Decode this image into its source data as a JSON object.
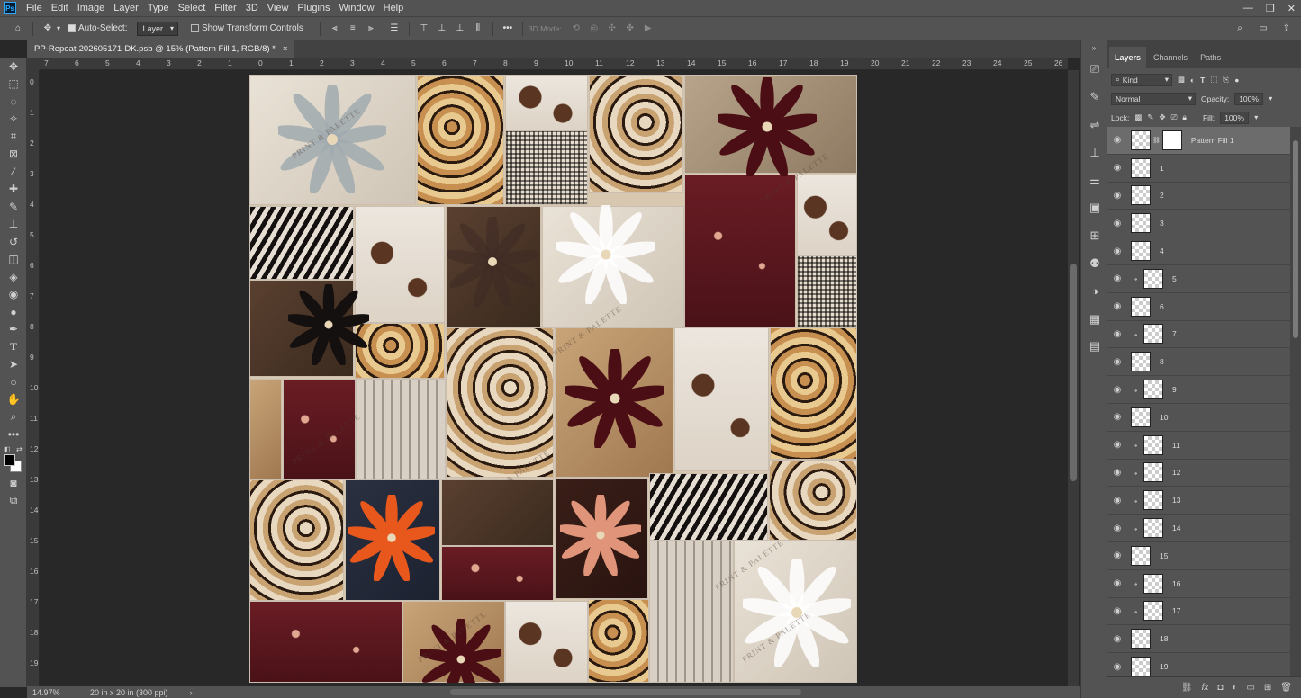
{
  "menubar": {
    "logo": "Ps",
    "items": [
      "File",
      "Edit",
      "Image",
      "Layer",
      "Type",
      "Select",
      "Filter",
      "3D",
      "View",
      "Plugins",
      "Window",
      "Help"
    ],
    "controls": [
      "—",
      "❐",
      "✕"
    ]
  },
  "options": {
    "auto_select_label": "Auto-Select:",
    "auto_select_value": "Layer",
    "transform_label": "Show Transform Controls",
    "mode_3d_label": "3D Mode:"
  },
  "document": {
    "tab_title": "PP-Repeat-202605171-DK.psb @ 15% (Pattern Fill 1, RGB/8) *",
    "close": "×",
    "watermark": "PRINT & PALETTE"
  },
  "rulers": {
    "h_labels": [
      "7",
      "6",
      "5",
      "4",
      "3",
      "2",
      "1",
      "0",
      "1",
      "2",
      "3",
      "4",
      "5",
      "6",
      "7",
      "8",
      "9",
      "10",
      "11",
      "12",
      "13",
      "14",
      "15",
      "16",
      "17",
      "18",
      "19",
      "20",
      "21",
      "22",
      "23",
      "24",
      "25",
      "26"
    ],
    "v_labels": [
      "0",
      "1",
      "2",
      "3",
      "4",
      "5",
      "6",
      "7",
      "8",
      "9",
      "10",
      "11",
      "12",
      "13",
      "14",
      "15",
      "16",
      "17",
      "18",
      "19"
    ]
  },
  "status": {
    "zoom": "14.97%",
    "doc_size": "20 in x 20 in (300 ppi)",
    "arrow": "›"
  },
  "layers_panel": {
    "tabs": [
      "Layers",
      "Channels",
      "Paths"
    ],
    "filter_kind": "Kind",
    "blend_mode": "Normal",
    "opacity_label": "Opacity:",
    "opacity_value": "100%",
    "lock_label": "Lock:",
    "fill_label": "Fill:",
    "fill_value": "100%",
    "layers": [
      {
        "name": "Pattern Fill 1",
        "clipped": false,
        "selected": true,
        "mask": true
      },
      {
        "name": "1",
        "clipped": false
      },
      {
        "name": "2",
        "clipped": false
      },
      {
        "name": "3",
        "clipped": false
      },
      {
        "name": "4",
        "clipped": false
      },
      {
        "name": "5",
        "clipped": true
      },
      {
        "name": "6",
        "clipped": false
      },
      {
        "name": "7",
        "clipped": true
      },
      {
        "name": "8",
        "clipped": false
      },
      {
        "name": "9",
        "clipped": true
      },
      {
        "name": "10",
        "clipped": false
      },
      {
        "name": "11",
        "clipped": true
      },
      {
        "name": "12",
        "clipped": true
      },
      {
        "name": "13",
        "clipped": true
      },
      {
        "name": "14",
        "clipped": true
      },
      {
        "name": "15",
        "clipped": false
      },
      {
        "name": "16",
        "clipped": true
      },
      {
        "name": "17",
        "clipped": true
      },
      {
        "name": "18",
        "clipped": false
      },
      {
        "name": "19",
        "clipped": false
      }
    ]
  },
  "colors": {
    "ui_dark": "#535353",
    "ui_canvas": "#282828",
    "accent": "#31a8ff"
  }
}
